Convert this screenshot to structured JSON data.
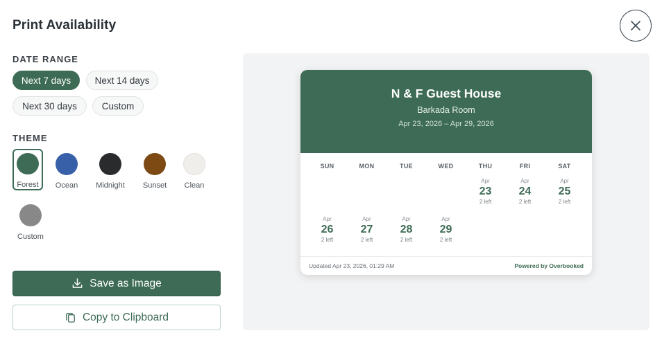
{
  "modal": {
    "title": "Print Availability"
  },
  "date_range": {
    "label": "DATE RANGE",
    "options": [
      "Next 7 days",
      "Next 14 days",
      "Next 30 days",
      "Custom"
    ],
    "selected": "Next 7 days"
  },
  "theme": {
    "label": "THEME",
    "selected": "Forest",
    "options": [
      {
        "name": "Forest",
        "color": "#3d6b55"
      },
      {
        "name": "Ocean",
        "color": "#3760a8"
      },
      {
        "name": "Midnight",
        "color": "#2a2b2c"
      },
      {
        "name": "Sunset",
        "color": "#7d4a14"
      },
      {
        "name": "Clean",
        "color": "#efeeeb"
      },
      {
        "name": "Custom",
        "color": "#888888"
      }
    ]
  },
  "actions": {
    "save_label": "Save as Image",
    "copy_label": "Copy to Clipboard"
  },
  "preview": {
    "property_name": "N & F Guest House",
    "room_name": "Barkada Room",
    "date_range": "Apr 23, 2026 – Apr 29, 2026",
    "weekdays": [
      "SUN",
      "MON",
      "TUE",
      "WED",
      "THU",
      "FRI",
      "SAT"
    ],
    "days": [
      {
        "month": "Apr",
        "day": "23",
        "availability": "2 left"
      },
      {
        "month": "Apr",
        "day": "24",
        "availability": "2 left"
      },
      {
        "month": "Apr",
        "day": "25",
        "availability": "2 left"
      },
      {
        "month": "Apr",
        "day": "26",
        "availability": "2 left"
      },
      {
        "month": "Apr",
        "day": "27",
        "availability": "2 left"
      },
      {
        "month": "Apr",
        "day": "28",
        "availability": "2 left"
      },
      {
        "month": "Apr",
        "day": "29",
        "availability": "2 left"
      }
    ],
    "updated": "Updated Apr 23, 2026, 01:29 AM",
    "powered_by": "Powered by Overbooked",
    "accent_color": "#3d6b55"
  }
}
